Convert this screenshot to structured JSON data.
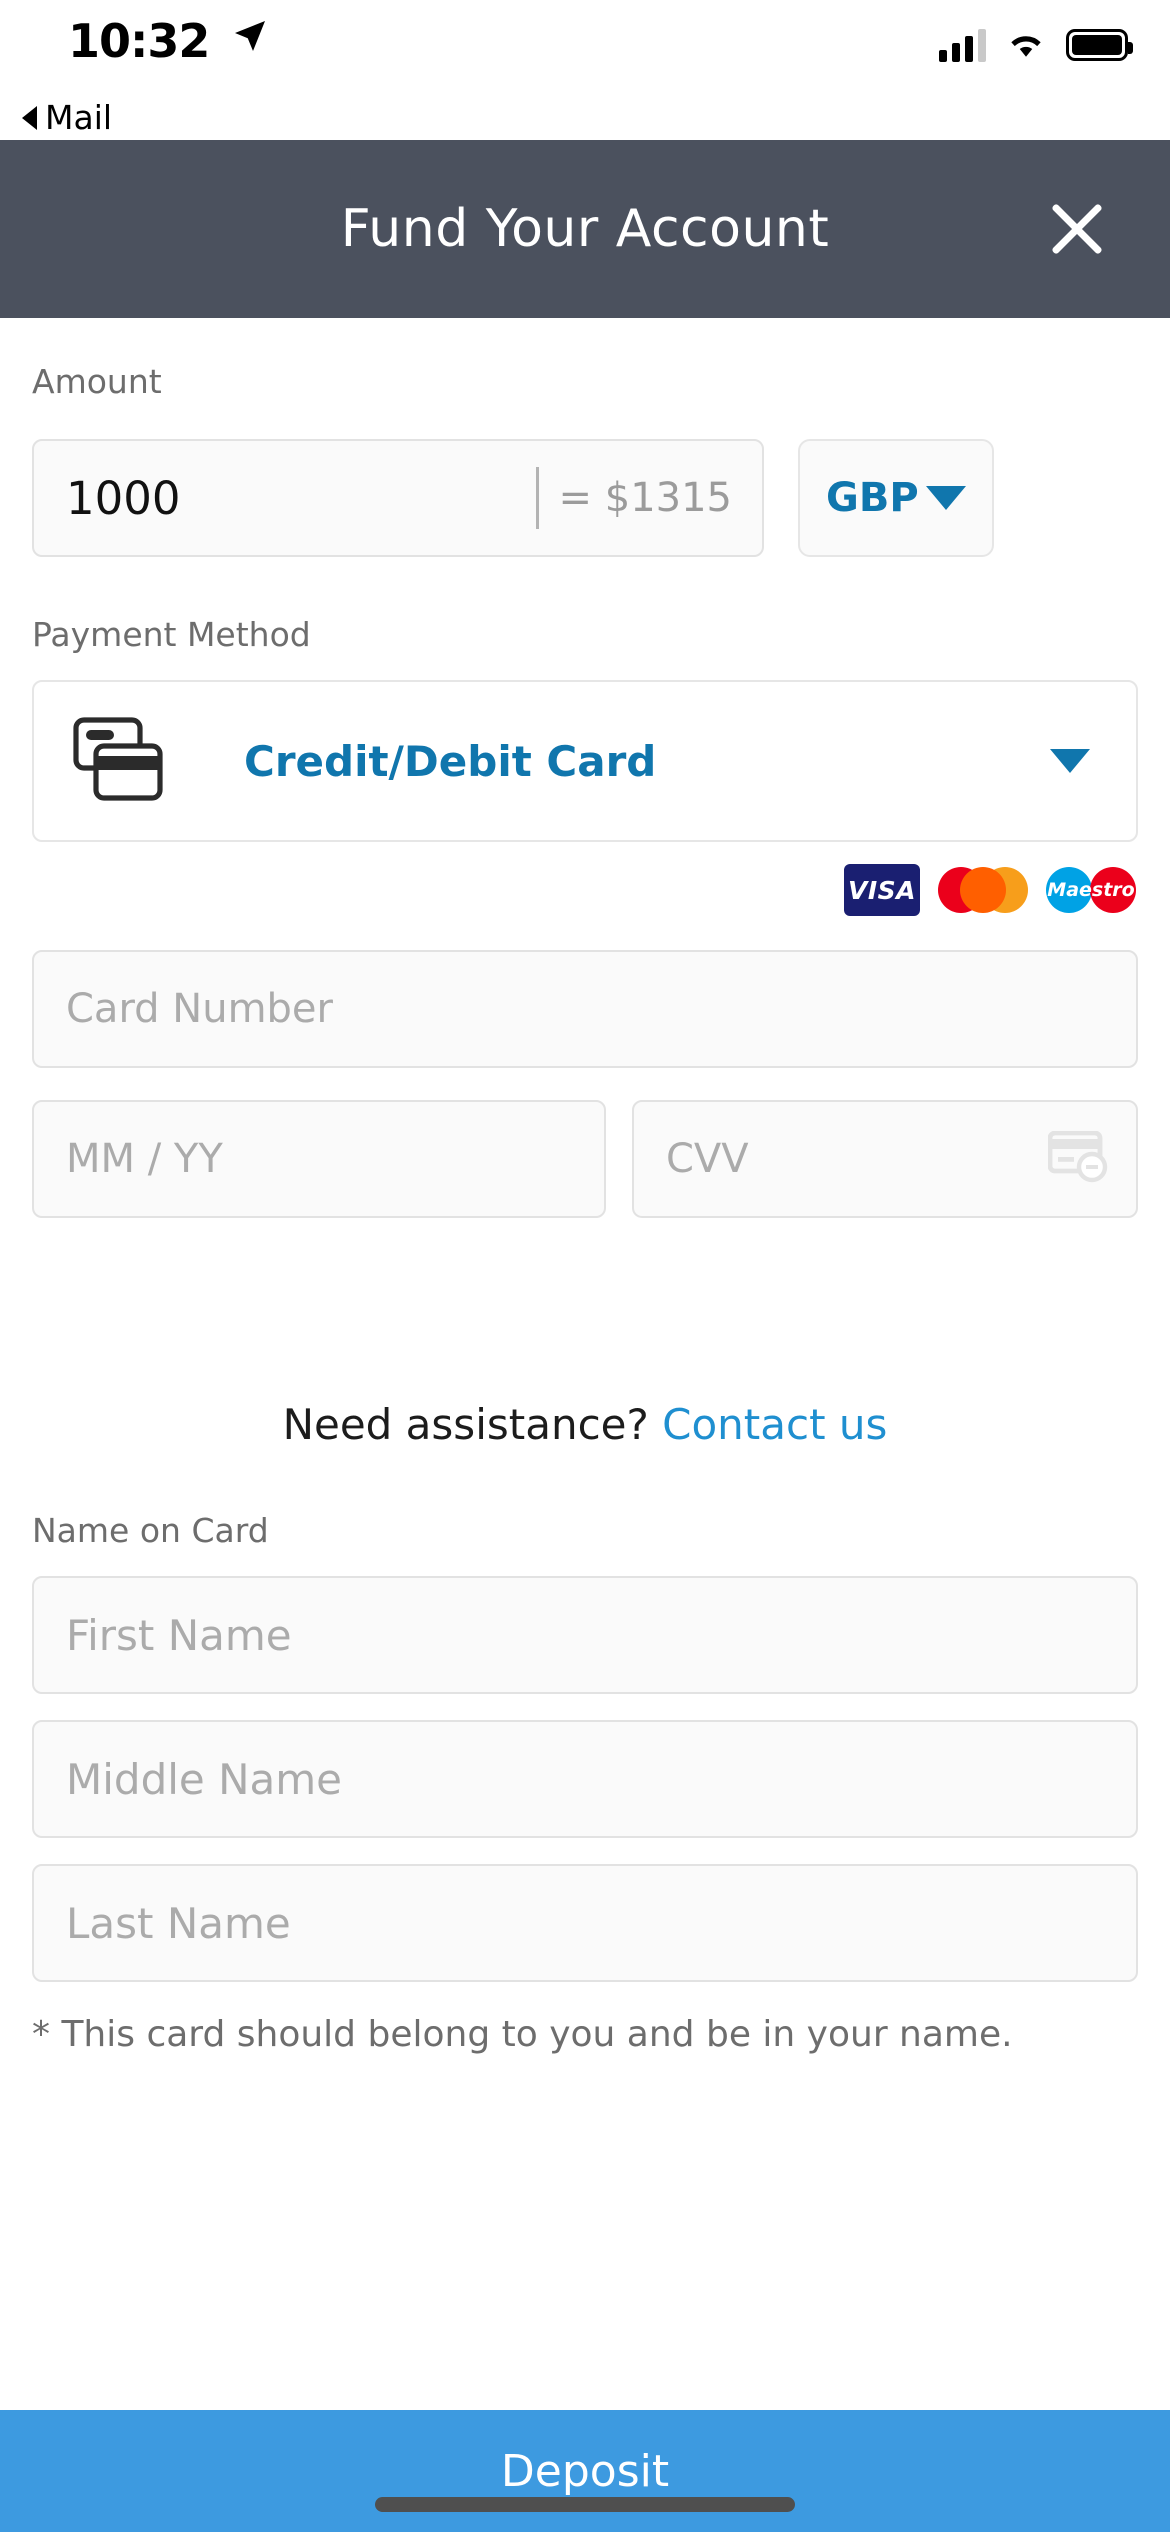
{
  "status_bar": {
    "time": "10:32",
    "location_icon": "location-arrow-icon",
    "signal_icon": "cellular-signal-icon",
    "wifi_icon": "wifi-icon",
    "battery_icon": "battery-icon",
    "back_label": "Mail"
  },
  "header": {
    "title": "Fund Your Account",
    "close_icon": "close-icon"
  },
  "amount_section": {
    "label": "Amount",
    "value": "1000",
    "placeholder": "Amount",
    "conversion": "= $1315",
    "currency": "GBP",
    "currency_caret_icon": "chevron-down-icon"
  },
  "payment_method_section": {
    "label": "Payment Method",
    "selected": "Credit/Debit Card",
    "card_icon": "credit-card-icon",
    "caret_icon": "chevron-down-icon",
    "brands": [
      {
        "name": "visa-logo",
        "text": "VISA"
      },
      {
        "name": "mastercard-logo",
        "text": ""
      },
      {
        "name": "maestro-logo",
        "text": "Maestro"
      }
    ]
  },
  "card_fields": {
    "card_number_placeholder": "Card Number",
    "card_number_value": "",
    "expiry_placeholder": "MM / YY",
    "expiry_value": "",
    "cvv_placeholder": "CVV",
    "cvv_value": "",
    "cvv_hint_icon": "card-cvv-icon"
  },
  "assistance": {
    "question": "Need assistance?",
    "link": "Contact us"
  },
  "name_section": {
    "label": "Name on Card",
    "first_placeholder": "First Name",
    "first_value": "",
    "middle_placeholder": "Middle Name",
    "middle_value": "",
    "last_placeholder": "Last Name",
    "last_value": ""
  },
  "disclaimer": "* This card should belong to you and be in your name.",
  "footer": {
    "deposit_label": "Deposit"
  },
  "colors": {
    "header_bg": "#4b515e",
    "accent_blue": "#1076ad",
    "link_blue": "#1f8fd0",
    "deposit_bg": "#3d9ae0",
    "placeholder_grey": "#ababab",
    "label_grey": "#6d6d6d"
  }
}
